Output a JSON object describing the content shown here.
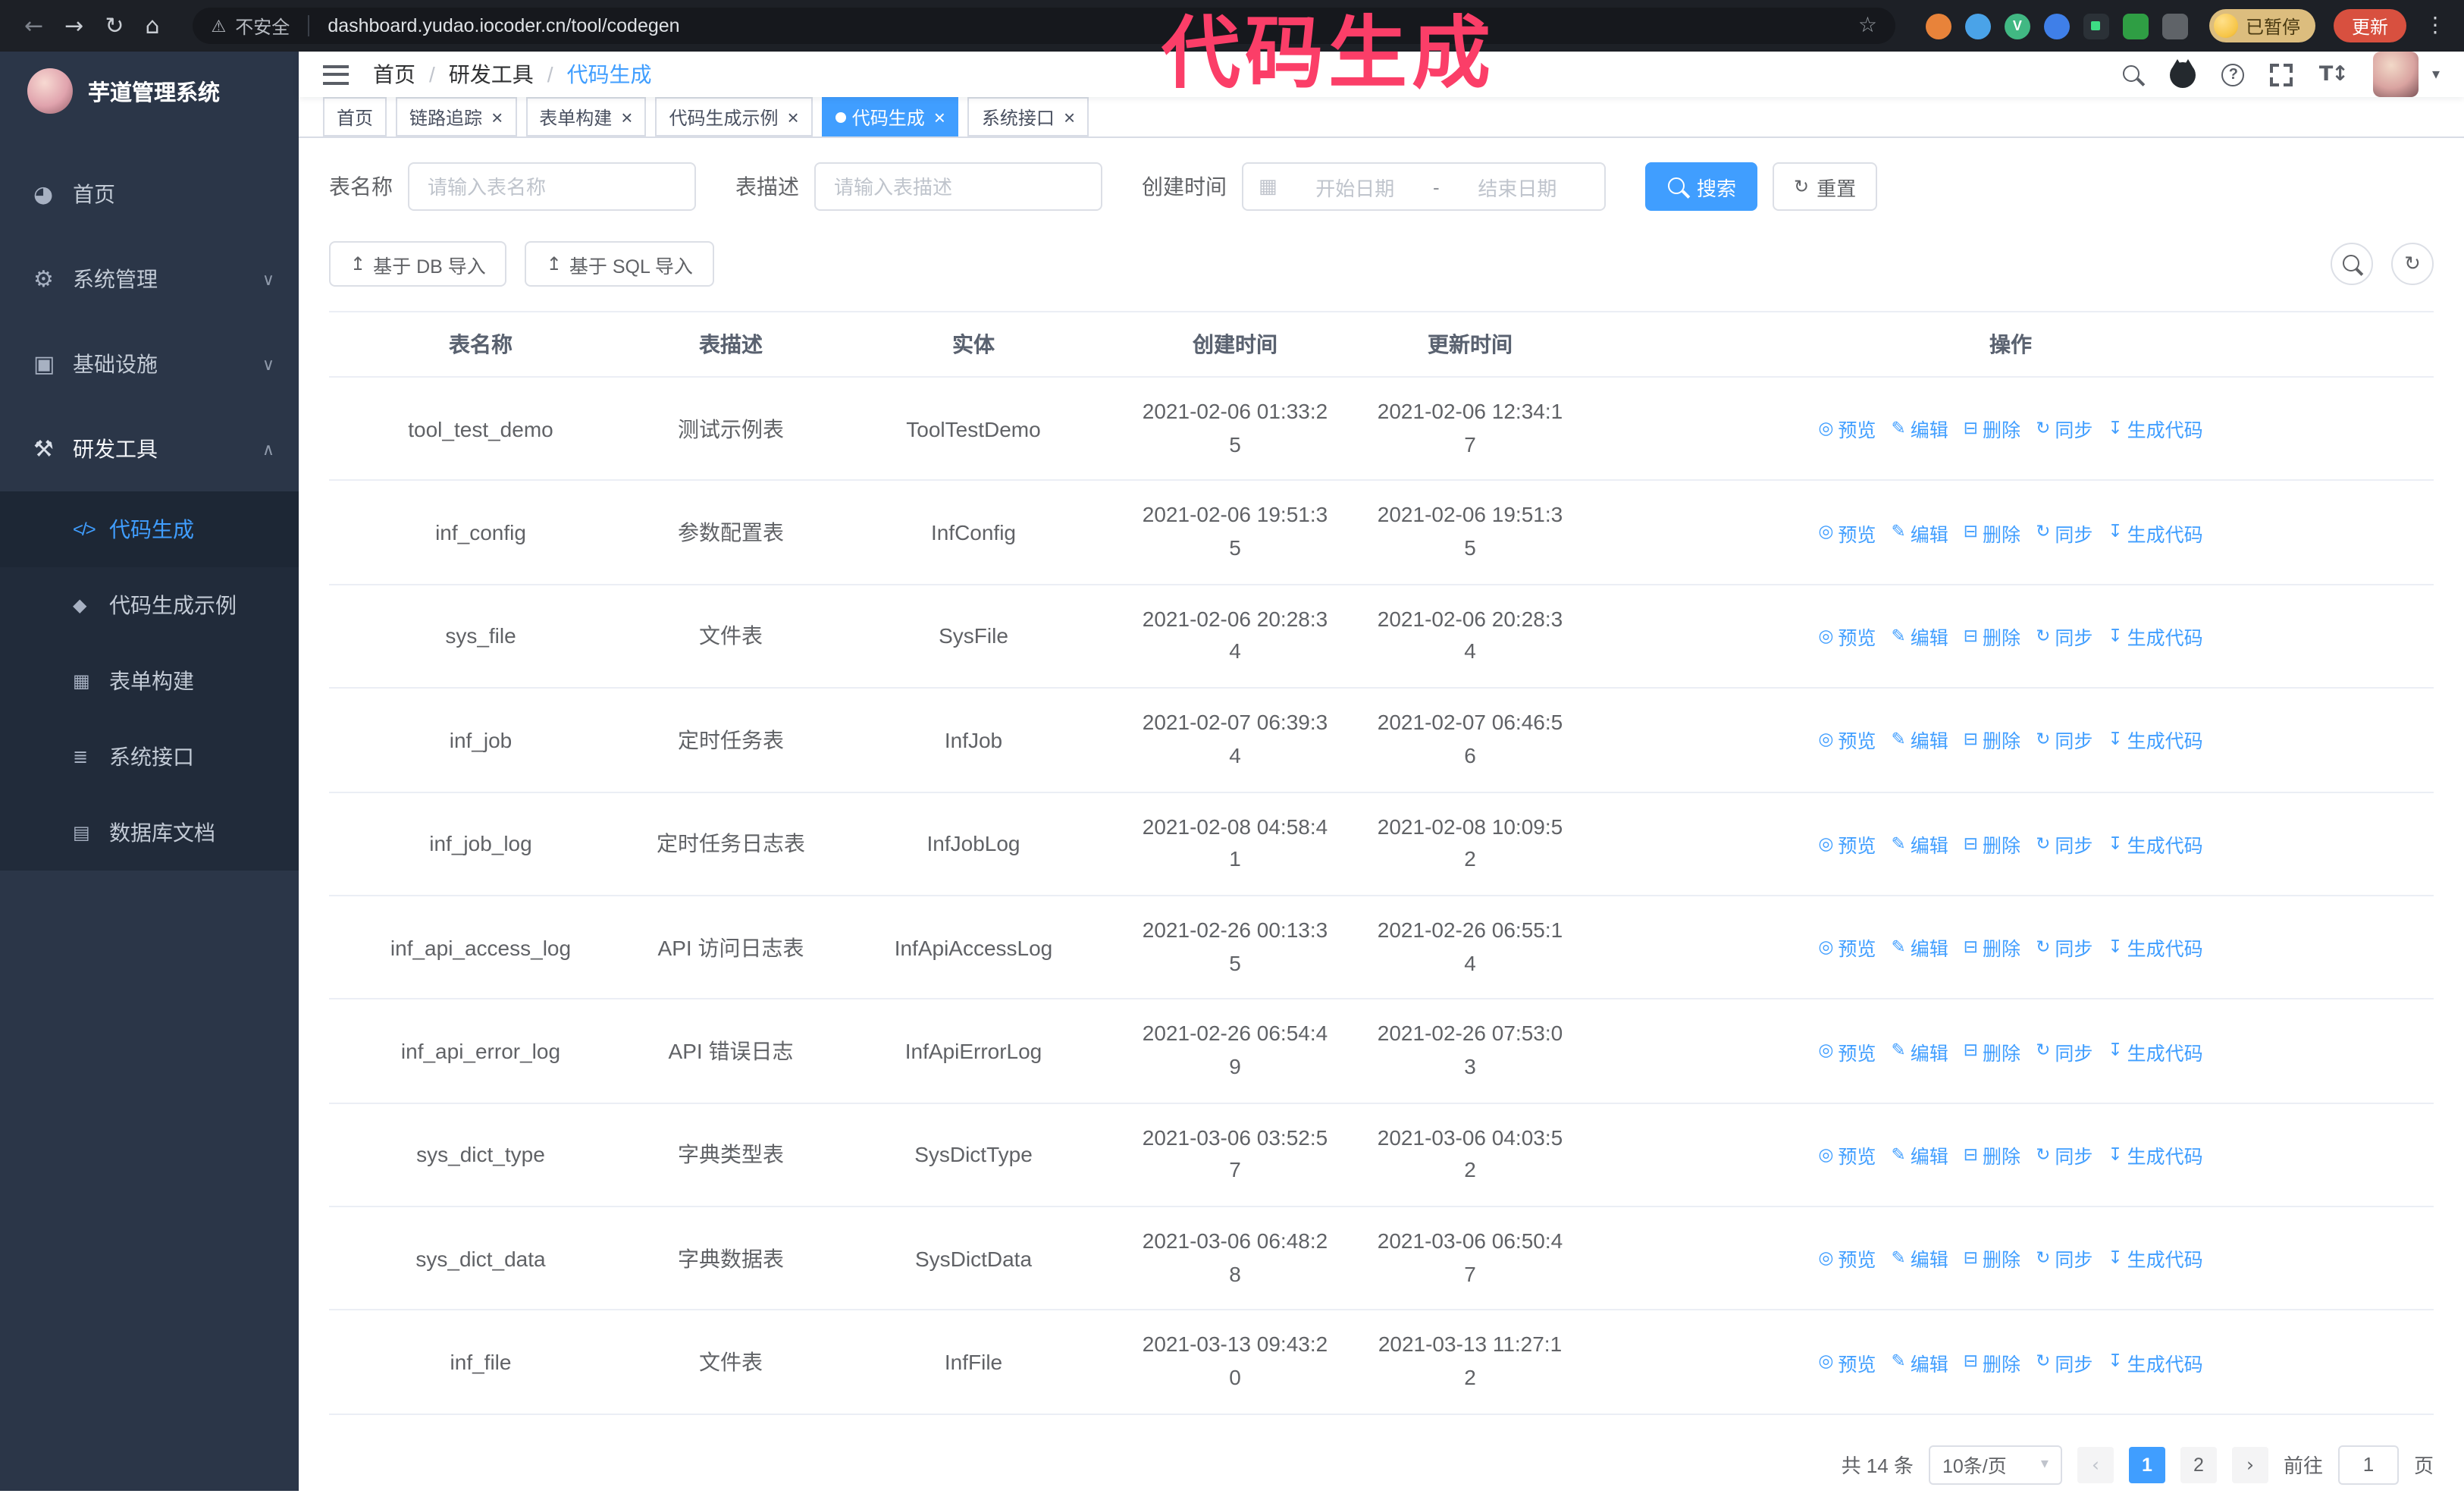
{
  "theme": {
    "accent": "#409eff",
    "sidebar_bg": "#2b3648",
    "submenu_bg": "#212b3a",
    "annotation_color": "#fb3e68",
    "update_button_color": "#d8503f",
    "paused_badge_color": "#dcbd7e"
  },
  "browser": {
    "security_label": "不安全",
    "url": "dashboard.yudao.iocoder.cn/tool/codegen",
    "paused_badge": "已暂停",
    "update_label": "更新"
  },
  "annotation": {
    "text": "代码生成"
  },
  "sidebar": {
    "logo_title": "芋道管理系统",
    "items": [
      {
        "label": "首页"
      },
      {
        "label": "系统管理"
      },
      {
        "label": "基础设施"
      },
      {
        "label": "研发工具"
      }
    ],
    "sub_items": [
      {
        "label": "代码生成"
      },
      {
        "label": "代码生成示例"
      },
      {
        "label": "表单构建"
      },
      {
        "label": "系统接口"
      },
      {
        "label": "数据库文档"
      }
    ]
  },
  "breadcrumb": {
    "separator": "/",
    "items": [
      "首页",
      "研发工具",
      "代码生成"
    ]
  },
  "tabs": [
    {
      "label": "首页"
    },
    {
      "label": "链路追踪"
    },
    {
      "label": "表单构建"
    },
    {
      "label": "代码生成示例"
    },
    {
      "label": "代码生成"
    },
    {
      "label": "系统接口"
    }
  ],
  "search_form": {
    "table_name_label": "表名称",
    "table_name_placeholder": "请输入表名称",
    "table_desc_label": "表描述",
    "table_desc_placeholder": "请输入表描述",
    "create_time_label": "创建时间",
    "date_start_placeholder": "开始日期",
    "date_separator": "-",
    "date_end_placeholder": "结束日期",
    "search_label": "搜索",
    "reset_label": "重置"
  },
  "toolbar": {
    "import_db_label": "基于 DB 导入",
    "import_sql_label": "基于 SQL 导入"
  },
  "table": {
    "columns": [
      "表名称",
      "表描述",
      "实体",
      "创建时间",
      "更新时间",
      "操作"
    ],
    "actions": [
      "预览",
      "编辑",
      "删除",
      "同步",
      "生成代码"
    ],
    "rows": [
      {
        "name": "tool_test_demo",
        "desc": "测试示例表",
        "entity": "ToolTestDemo",
        "created": "2021-02-06 01:33:25",
        "updated": "2021-02-06 12:34:17"
      },
      {
        "name": "inf_config",
        "desc": "参数配置表",
        "entity": "InfConfig",
        "created": "2021-02-06 19:51:35",
        "updated": "2021-02-06 19:51:35"
      },
      {
        "name": "sys_file",
        "desc": "文件表",
        "entity": "SysFile",
        "created": "2021-02-06 20:28:34",
        "updated": "2021-02-06 20:28:34"
      },
      {
        "name": "inf_job",
        "desc": "定时任务表",
        "entity": "InfJob",
        "created": "2021-02-07 06:39:34",
        "updated": "2021-02-07 06:46:56"
      },
      {
        "name": "inf_job_log",
        "desc": "定时任务日志表",
        "entity": "InfJobLog",
        "created": "2021-02-08 04:58:41",
        "updated": "2021-02-08 10:09:52"
      },
      {
        "name": "inf_api_access_log",
        "desc": "API 访问日志表",
        "entity": "InfApiAccessLog",
        "created": "2021-02-26 00:13:35",
        "updated": "2021-02-26 06:55:14"
      },
      {
        "name": "inf_api_error_log",
        "desc": "API 错误日志",
        "entity": "InfApiErrorLog",
        "created": "2021-02-26 06:54:49",
        "updated": "2021-02-26 07:53:03"
      },
      {
        "name": "sys_dict_type",
        "desc": "字典类型表",
        "entity": "SysDictType",
        "created": "2021-03-06 03:52:57",
        "updated": "2021-03-06 04:03:52"
      },
      {
        "name": "sys_dict_data",
        "desc": "字典数据表",
        "entity": "SysDictData",
        "created": "2021-03-06 06:48:28",
        "updated": "2021-03-06 06:50:47"
      },
      {
        "name": "inf_file",
        "desc": "文件表",
        "entity": "InfFile",
        "created": "2021-03-13 09:43:20",
        "updated": "2021-03-13 11:27:12"
      }
    ]
  },
  "pagination": {
    "total": "共 14 条",
    "page_size": "10条/页",
    "page_1": "1",
    "page_2": "2",
    "goto_label": "前往",
    "goto_value": "1",
    "goto_unit": "页"
  },
  "icons": {
    "back": "←",
    "forward": "→",
    "reload": "↻",
    "home": "⌂",
    "warning": "⚠",
    "star": "☆",
    "kebab": "⋮",
    "close": "×",
    "menu_home": "◕",
    "menu_system": "⚙",
    "menu_infra": "▣",
    "menu_devtools": "⚒",
    "menu_codegen": "</>",
    "menu_demo": "◆",
    "menu_form": "▦",
    "menu_api": "≣",
    "menu_db": "▤",
    "chevron_down": "∨",
    "chevron_up": "∧",
    "caret_down": "▾",
    "calendar": "▦",
    "upload": "↥",
    "download": "↧",
    "refresh": "↻",
    "eye": "◎",
    "edit": "✎",
    "delete": "⊟",
    "sync": "↻",
    "font_size": "T↕",
    "prev": "‹",
    "next": "›"
  }
}
